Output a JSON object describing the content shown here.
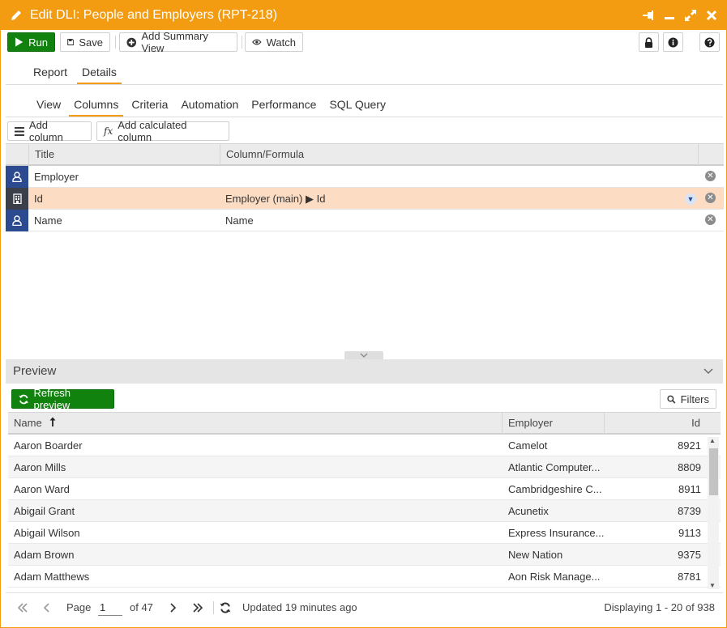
{
  "window": {
    "title": "Edit DLI: People and Employers (RPT-218)",
    "accent": "#f39c12"
  },
  "toolbar": {
    "run_label": "Run",
    "save_label": "Save",
    "add_summary_label": "Add Summary View",
    "watch_label": "Watch"
  },
  "main_tabs": [
    {
      "label": "Report",
      "active": false
    },
    {
      "label": "Details",
      "active": true
    }
  ],
  "sub_tabs": [
    {
      "label": "View",
      "active": false
    },
    {
      "label": "Columns",
      "active": true
    },
    {
      "label": "Criteria",
      "active": false
    },
    {
      "label": "Automation",
      "active": false
    },
    {
      "label": "Performance",
      "active": false
    },
    {
      "label": "SQL Query",
      "active": false
    }
  ],
  "column_buttons": {
    "add_column": "Add column",
    "fx": "fx",
    "add_calculated": "Add calculated column"
  },
  "columns_grid": {
    "headers": {
      "title": "Title",
      "formula": "Column/Formula"
    },
    "rows": [
      {
        "title": "Employer",
        "formula": "",
        "icon": "person-icon",
        "selected": false
      },
      {
        "title": "Id",
        "formula": "Employer (main) ▶ Id",
        "icon": "building-icon",
        "selected": true
      },
      {
        "title": "Name",
        "formula": "Name",
        "icon": "person-icon",
        "selected": false
      }
    ]
  },
  "preview": {
    "header": "Preview",
    "refresh_label": "Refresh preview",
    "filters_label": "Filters",
    "headers": {
      "name": "Name",
      "employer": "Employer",
      "id": "Id"
    },
    "rows": [
      {
        "name": "Aaron Boarder",
        "employer": "Camelot",
        "id": "8921"
      },
      {
        "name": "Aaron Mills",
        "employer": "Atlantic Computer...",
        "id": "8809"
      },
      {
        "name": "Aaron Ward",
        "employer": "Cambridgeshire C...",
        "id": "8911"
      },
      {
        "name": "Abigail Grant",
        "employer": "Acunetix",
        "id": "8739"
      },
      {
        "name": "Abigail Wilson",
        "employer": "Express Insurance...",
        "id": "9113"
      },
      {
        "name": "Adam Brown",
        "employer": "New Nation",
        "id": "9375"
      },
      {
        "name": "Adam Matthews",
        "employer": "Aon Risk Manage...",
        "id": "8781"
      }
    ]
  },
  "pager": {
    "page_label": "Page",
    "page_value": "1",
    "of_label": "of 47",
    "updated": "Updated 19 minutes ago",
    "displaying": "Displaying 1 - 20 of 938"
  }
}
